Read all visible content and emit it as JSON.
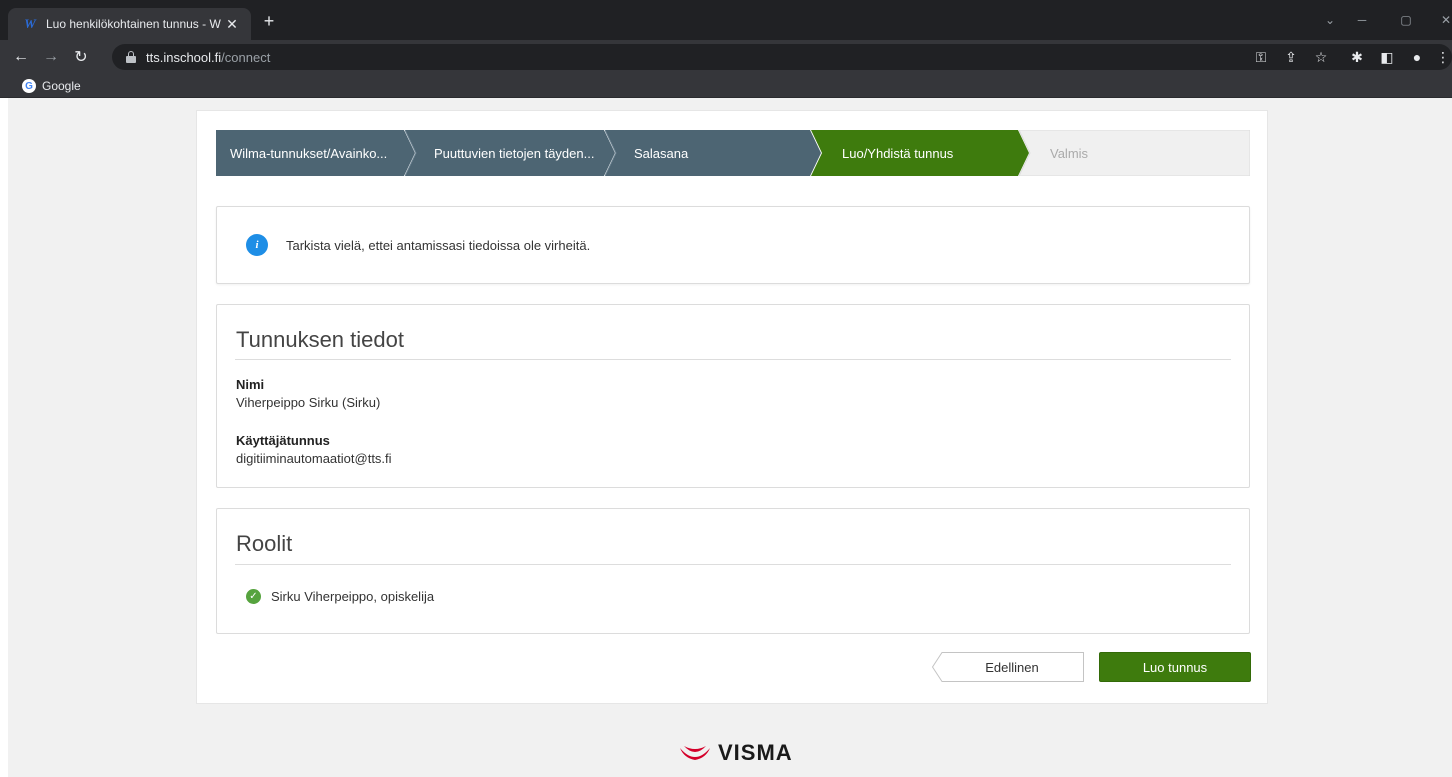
{
  "browser": {
    "tab_title": "Luo henkilökohtainen tunnus - W",
    "url_host": "tts.inschool.fi",
    "url_path": "/connect",
    "bookmark_label": "Google"
  },
  "colors": {
    "step_done": "#4d6573",
    "step_active": "#3e7b0d",
    "step_pending": "#f0f0f0",
    "primary_button": "#3e7b0d",
    "info_icon": "#1e8ee6",
    "check_icon": "#56a33e"
  },
  "stepper": {
    "steps": [
      {
        "label": "Wilma-tunnukset/Avainko...",
        "state": "done"
      },
      {
        "label": "Puuttuvien tietojen täyden...",
        "state": "done"
      },
      {
        "label": "Salasana",
        "state": "done"
      },
      {
        "label": "Luo/Yhdistä tunnus",
        "state": "active"
      },
      {
        "label": "Valmis",
        "state": "pending"
      }
    ]
  },
  "info": {
    "icon": "info-icon",
    "text": "Tarkista vielä, ettei antamissasi tiedoissa ole virheitä."
  },
  "details": {
    "title": "Tunnuksen tiedot",
    "name_label": "Nimi",
    "name_value": "Viherpeippo Sirku (Sirku)",
    "username_label": "Käyttäjätunnus",
    "username_value": "digitiiminautomaatiot@tts.fi"
  },
  "roles": {
    "title": "Roolit",
    "items": [
      {
        "text": "Sirku Viherpeippo, opiskelija",
        "icon": "check-circle-icon"
      }
    ]
  },
  "actions": {
    "previous_label": "Edellinen",
    "create_label": "Luo tunnus"
  },
  "footer": {
    "logo_text": "VISMA"
  }
}
